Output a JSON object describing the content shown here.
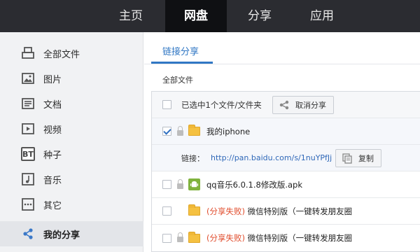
{
  "topnav": {
    "items": [
      {
        "label": "主页"
      },
      {
        "label": "网盘"
      },
      {
        "label": "分享"
      },
      {
        "label": "应用"
      }
    ],
    "active": "网盘"
  },
  "sidebar": {
    "items": [
      {
        "label": "全部文件",
        "icon": "printer-icon"
      },
      {
        "label": "图片",
        "icon": "image-icon"
      },
      {
        "label": "文档",
        "icon": "document-icon"
      },
      {
        "label": "视频",
        "icon": "video-icon"
      },
      {
        "label": "种子",
        "icon": "bt-torrent-icon",
        "icon_text": "BT"
      },
      {
        "label": "音乐",
        "icon": "music-note-icon"
      },
      {
        "label": "其它",
        "icon": "more-dots-icon"
      },
      {
        "label": "我的分享",
        "icon": "share-icon"
      }
    ],
    "active": "我的分享"
  },
  "main": {
    "tab": "链接分享",
    "breadcrumb": "全部文件",
    "header": {
      "selected_text": "已选中1个文件/文件夹",
      "cancel_share_label": "取消分享"
    },
    "rows": [
      {
        "type": "folder",
        "name": "我的iphone",
        "checked": true,
        "locked": true
      },
      {
        "type": "link",
        "link_label": "链接：",
        "url": "http://pan.baidu.com/s/1nuYPfJj",
        "copy_label": "复制"
      },
      {
        "type": "apk",
        "name": "qq音乐6.0.1.8修改版.apk",
        "checked": false,
        "locked": true
      },
      {
        "type": "folder",
        "status": "(分享失败)",
        "name": " 微信特别版（一键转发朋友圈",
        "checked": false,
        "locked": false
      },
      {
        "type": "folder",
        "status": "(分享失败)",
        "name": " 微信特别版（一键转发朋友圈",
        "checked": false,
        "locked": true
      }
    ]
  },
  "colors": {
    "nav_bg": "#2b2c31",
    "nav_active_bg": "#0f1013",
    "accent": "#3077c4",
    "fail": "#e04b2b",
    "folder": "#f5c141",
    "apk": "#7fb23d"
  }
}
